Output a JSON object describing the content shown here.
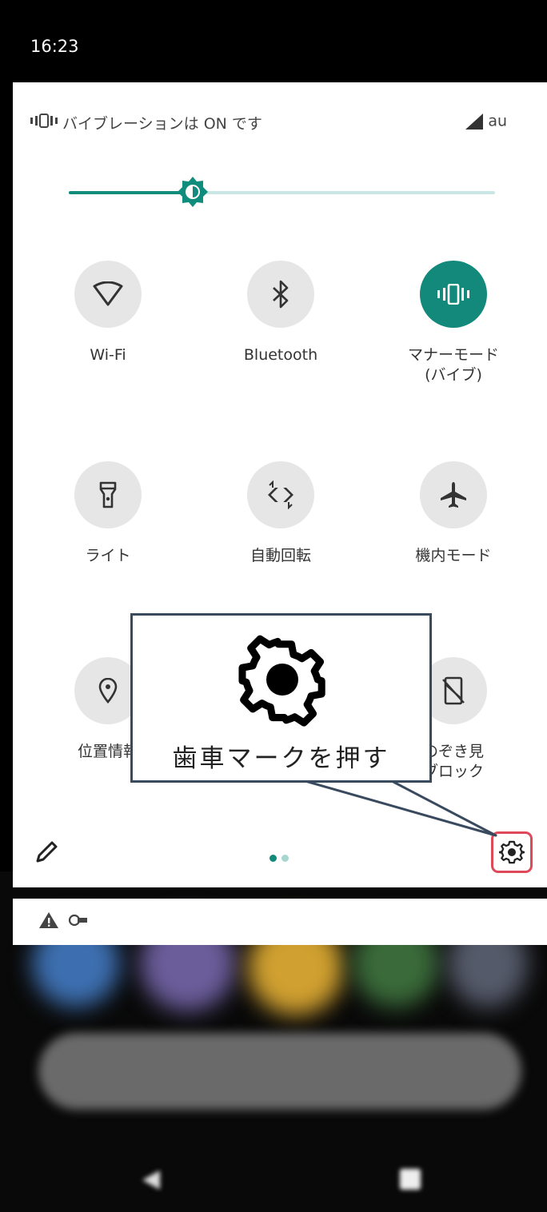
{
  "status_bar": {
    "time": "16:23"
  },
  "notification": {
    "vibration_text": "バイブレーションは ON です",
    "carrier": "au"
  },
  "brightness": {
    "level": 0.29
  },
  "tiles": [
    {
      "id": "wifi",
      "label": "Wi-Fi",
      "icon": "wifi-icon",
      "active": false
    },
    {
      "id": "bluetooth",
      "label": "Bluetooth",
      "icon": "bluetooth-icon",
      "active": false
    },
    {
      "id": "manner",
      "label": "マナーモード\n(バイブ)",
      "icon": "vibrate-icon",
      "active": true
    },
    {
      "id": "light",
      "label": "ライト",
      "icon": "flashlight-icon",
      "active": false
    },
    {
      "id": "rotate",
      "label": "自動回転",
      "icon": "auto-rotate-icon",
      "active": false
    },
    {
      "id": "airplane",
      "label": "機内モード",
      "icon": "airplane-icon",
      "active": false
    },
    {
      "id": "location",
      "label": "位置情報",
      "icon": "location-icon",
      "active": false
    },
    {
      "id": "peek",
      "label": "のぞき見\nブロック",
      "icon": "peek-block-icon",
      "active": false
    }
  ],
  "page_indicator": {
    "count": 2,
    "current": 1
  },
  "callout": {
    "text": "歯車マークを押す"
  },
  "colors": {
    "accent": "#12897a",
    "highlight": "#e0495a",
    "callout_border": "#3a4a5e"
  }
}
